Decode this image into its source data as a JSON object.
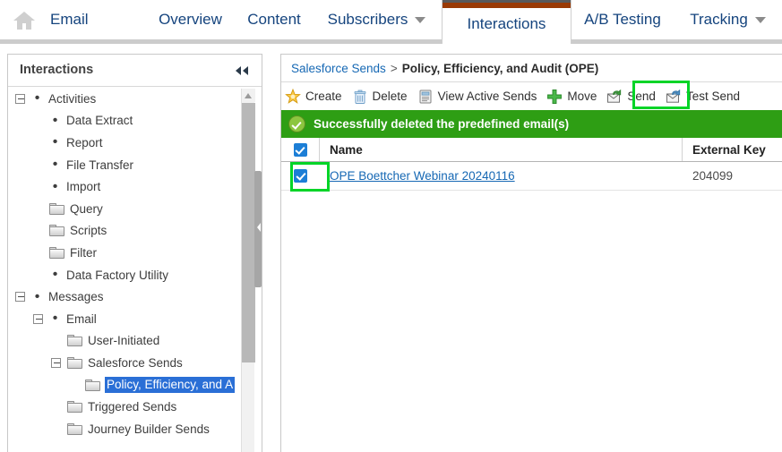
{
  "topnav": {
    "home_icon": "home-icon",
    "brand": "Email",
    "items": [
      {
        "label": "Overview",
        "has_caret": false,
        "active": false
      },
      {
        "label": "Content",
        "has_caret": false,
        "active": false
      },
      {
        "label": "Subscribers",
        "has_caret": true,
        "active": false
      },
      {
        "label": "Interactions",
        "has_caret": true,
        "active": true
      },
      {
        "label": "A/B Testing",
        "has_caret": false,
        "active": false
      },
      {
        "label": "Tracking",
        "has_caret": true,
        "active": false
      }
    ],
    "active_tab_accent_color": "#9a3a05"
  },
  "sidebar": {
    "title": "Interactions",
    "collapse_icon": "double-chevron-left-icon",
    "tree": [
      {
        "label": "Activities",
        "indent": 0,
        "expander": "minus",
        "marker": "bullet",
        "selected": false
      },
      {
        "label": "Data Extract",
        "indent": 1,
        "expander": "none",
        "marker": "bullet",
        "selected": false
      },
      {
        "label": "Report",
        "indent": 1,
        "expander": "none",
        "marker": "bullet",
        "selected": false
      },
      {
        "label": "File Transfer",
        "indent": 1,
        "expander": "none",
        "marker": "bullet",
        "selected": false
      },
      {
        "label": "Import",
        "indent": 1,
        "expander": "none",
        "marker": "bullet",
        "selected": false
      },
      {
        "label": "Query",
        "indent": 1,
        "expander": "none",
        "marker": "folder",
        "selected": false
      },
      {
        "label": "Scripts",
        "indent": 1,
        "expander": "none",
        "marker": "folder",
        "selected": false
      },
      {
        "label": "Filter",
        "indent": 1,
        "expander": "none",
        "marker": "folder",
        "selected": false
      },
      {
        "label": "Data Factory Utility",
        "indent": 1,
        "expander": "none",
        "marker": "bullet",
        "selected": false
      },
      {
        "label": "Messages",
        "indent": 0,
        "expander": "minus",
        "marker": "bullet",
        "selected": false
      },
      {
        "label": "Email",
        "indent": 1,
        "expander": "minus",
        "marker": "bullet",
        "selected": false
      },
      {
        "label": "User-Initiated",
        "indent": 2,
        "expander": "none",
        "marker": "folder",
        "selected": false
      },
      {
        "label": "Salesforce Sends",
        "indent": 2,
        "expander": "minus",
        "marker": "folder",
        "selected": false
      },
      {
        "label": "Policy, Efficiency, and A",
        "indent": 3,
        "expander": "none",
        "marker": "folder",
        "selected": true
      },
      {
        "label": "Triggered Sends",
        "indent": 2,
        "expander": "none",
        "marker": "folder",
        "selected": false
      },
      {
        "label": "Journey Builder Sends",
        "indent": 2,
        "expander": "none",
        "marker": "folder",
        "selected": false
      }
    ],
    "selection_color": "#2a6fd6"
  },
  "main": {
    "breadcrumb": {
      "parent": "Salesforce Sends",
      "separator": ">",
      "current": "Policy, Efficiency, and Audit (OPE)"
    },
    "toolbar": [
      {
        "label": "Create",
        "icon": "star-icon"
      },
      {
        "label": "Delete",
        "icon": "trash-icon"
      },
      {
        "label": "View Active Sends",
        "icon": "document-icon"
      },
      {
        "label": "Move",
        "icon": "plus-arrows-icon"
      },
      {
        "label": "Send",
        "icon": "envelope-green-arrow-icon"
      },
      {
        "label": "Test Send",
        "icon": "envelope-blue-arrow-icon"
      }
    ],
    "status": {
      "icon": "success-check-icon",
      "message": "Successfully deleted the predefined email(s)",
      "background_color": "#2e9e14"
    },
    "table": {
      "headers": [
        "Name",
        "External Key"
      ],
      "header_select_all_checked": true,
      "rows": [
        {
          "checked": true,
          "name": "OPE Boettcher Webinar 20240116",
          "external_key": "204099"
        }
      ]
    },
    "highlights": {
      "send_button": "#00d427",
      "row_checkbox": "#00d427"
    }
  }
}
